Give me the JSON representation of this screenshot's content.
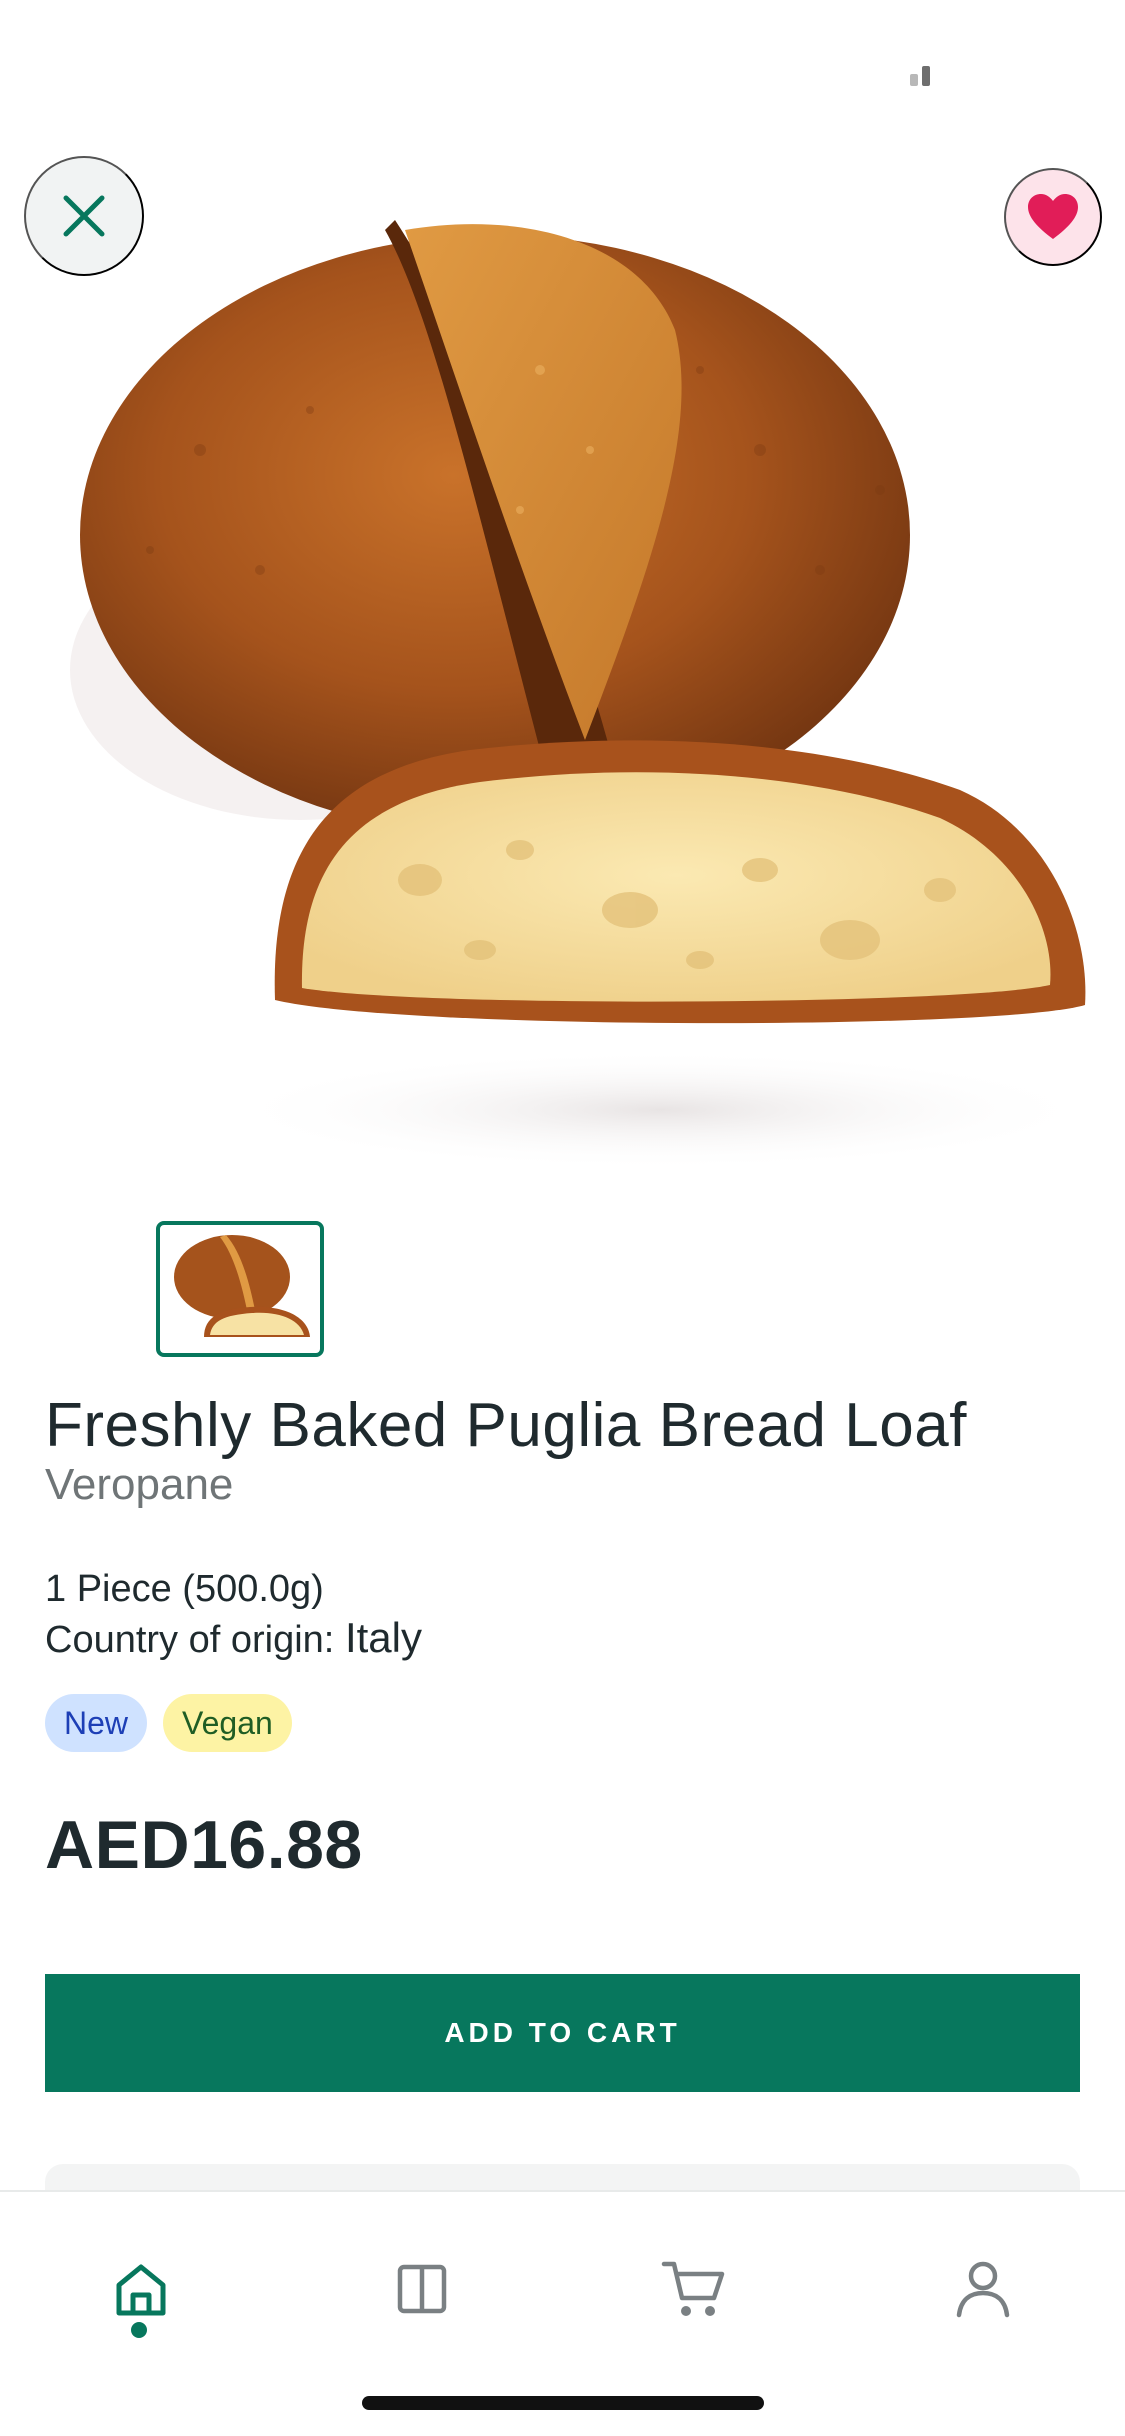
{
  "product": {
    "title": "Freshly Baked Puglia Bread Loaf",
    "brand": "Veropane",
    "size": "1 Piece (500.0g)",
    "origin_label": "Country of origin:",
    "origin_value": "Italy",
    "badges": [
      {
        "label": "New",
        "color": "#cfe2ff"
      },
      {
        "label": "Vegan",
        "color": "#fdf3a4"
      }
    ],
    "price": "AED16.88"
  },
  "actions": {
    "add_to_cart": "ADD TO CART",
    "favorited": true
  },
  "gallery": {
    "image_count": 1,
    "selected_index": 0
  },
  "tabbar": {
    "items": [
      {
        "icon": "home-icon",
        "active": true
      },
      {
        "icon": "catalog-icon",
        "active": false
      },
      {
        "icon": "cart-icon",
        "active": false
      },
      {
        "icon": "account-icon",
        "active": false
      }
    ]
  },
  "colors": {
    "primary": "#07775d",
    "favorite": "#e11d58",
    "text": "#1f2a2e"
  }
}
